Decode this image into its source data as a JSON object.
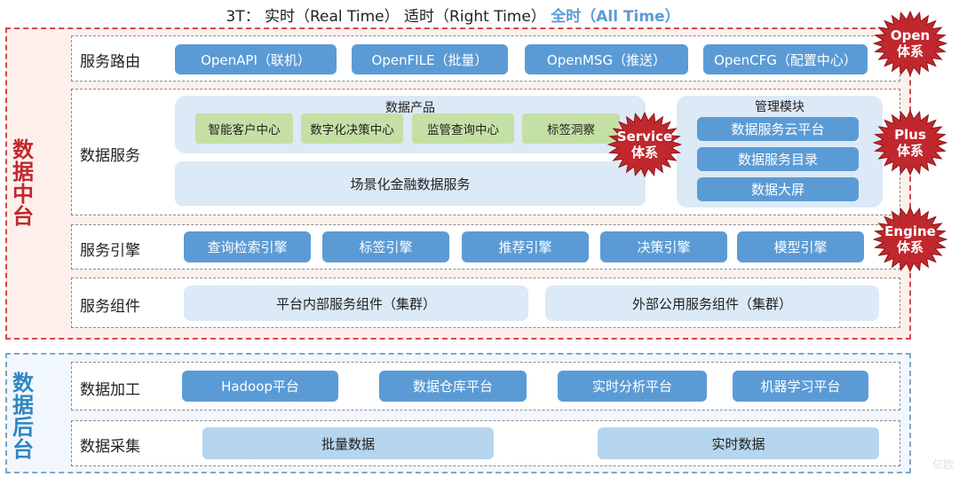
{
  "title": {
    "prefix": "3T： 实时（Real Time） 适时（Right Time）",
    "highlight": "全时（All Time）"
  },
  "colors": {
    "accent_red": "#c0282d",
    "accent_blue": "#5b9bd5",
    "back_label_blue": "#2e86c1",
    "green": "#c5e0a5"
  },
  "zones": {
    "middle": {
      "label": "数据中台"
    },
    "back": {
      "label": "数据后台"
    }
  },
  "service_routing": {
    "label": "服务路由",
    "items": [
      "OpenAPI（联机）",
      "OpenFILE（批量）",
      "OpenMSG（推送）",
      "OpenCFG（配置中心）"
    ]
  },
  "data_service": {
    "label": "数据服务",
    "products": {
      "title": "数据产品",
      "items": [
        "智能客户中心",
        "数字化决策中心",
        "监管查询中心",
        "标签洞察"
      ]
    },
    "scenario": "场景化金融数据服务",
    "management": {
      "title": "管理模块",
      "items": [
        "数据服务云平台",
        "数据服务目录",
        "数据大屏"
      ]
    }
  },
  "service_engine": {
    "label": "服务引擎",
    "items": [
      "查询检索引擎",
      "标签引擎",
      "推荐引擎",
      "决策引擎",
      "模型引擎"
    ]
  },
  "service_components": {
    "label": "服务组件",
    "items": [
      "平台内部服务组件（集群）",
      "外部公用服务组件（集群）"
    ]
  },
  "data_processing": {
    "label": "数据加工",
    "items": [
      "Hadoop平台",
      "数据仓库平台",
      "实时分析平台",
      "机器学习平台"
    ]
  },
  "data_collection": {
    "label": "数据采集",
    "items": [
      "批量数据",
      "实时数据"
    ]
  },
  "badges": [
    {
      "line1": "Open",
      "line2": "体系"
    },
    {
      "line1": "Service",
      "line2": "体系"
    },
    {
      "line1": "Plus",
      "line2": "体系"
    },
    {
      "line1": "Engine",
      "line2": "体系"
    }
  ],
  "watermark": "亿欧"
}
